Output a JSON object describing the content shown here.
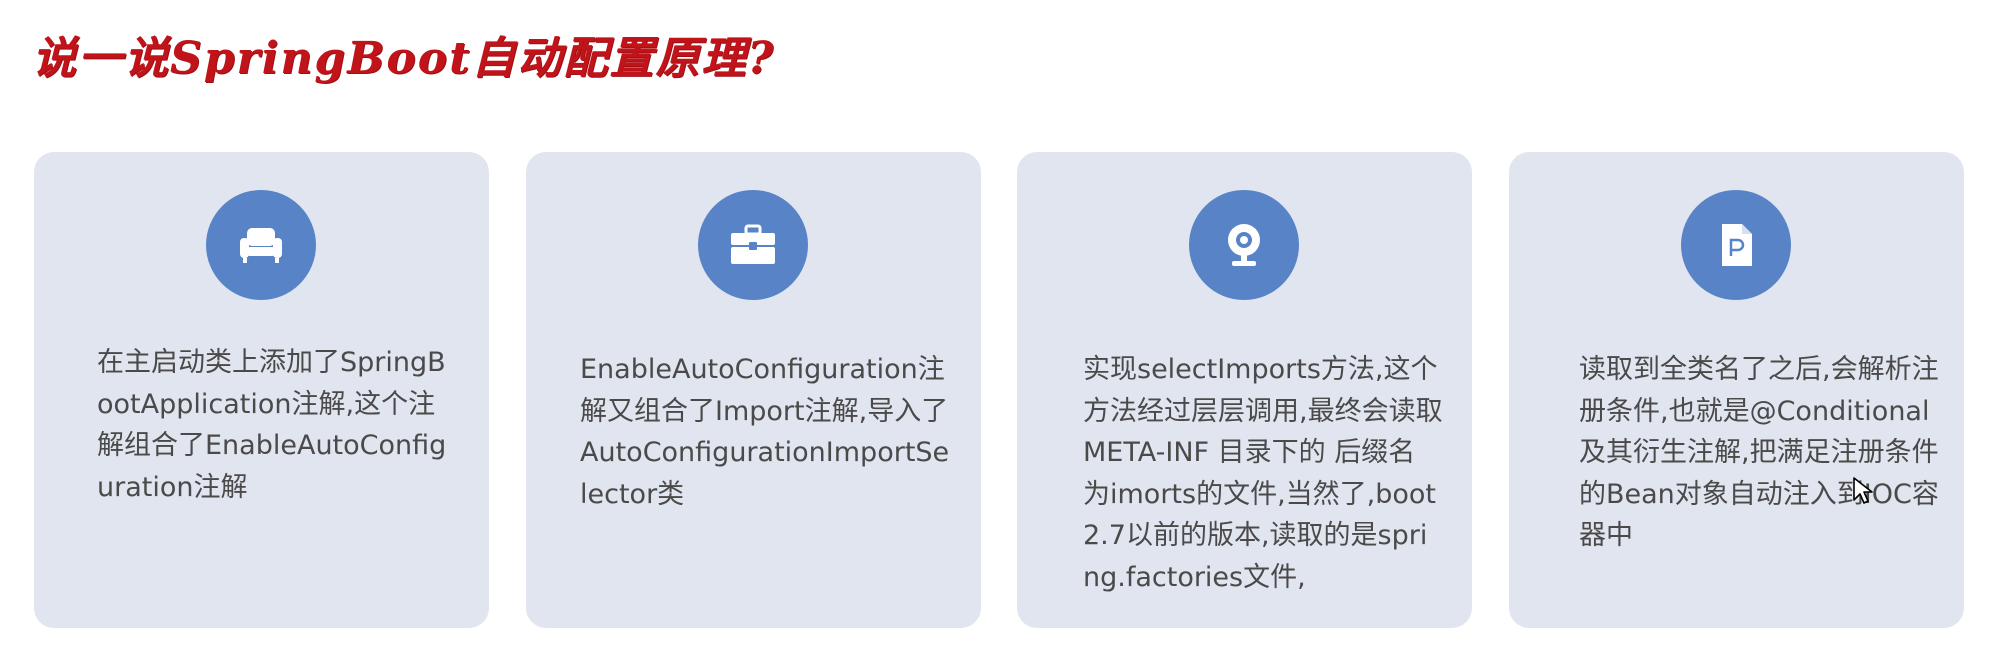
{
  "title": "说一说SpringBoot自动配置原理?",
  "cards": [
    {
      "icon": "armchair-icon",
      "text": "在主启动类上添加了SpringBootApplication注解,这个注解组合了EnableAutoConfiguration注解"
    },
    {
      "icon": "toolbox-icon",
      "text": "EnableAutoConfiguration注解又组合了Import注解,导入了AutoConfigurationImportSelector类"
    },
    {
      "icon": "webcam-icon",
      "text": "实现selectImports方法,这个方法经过层层调用,最终会读取META-INF 目录下的 后缀名 为imorts的文件,当然了,boot2.7以前的版本,读取的是spring.factories文件,"
    },
    {
      "icon": "p-document-icon",
      "text": "读取到全类名了之后,会解析注册条件,也就是@Conditional及其衍生注解,把满足注册条件的Bean对象自动注入到IOC容器中"
    }
  ],
  "colors": {
    "title": "#c0141a",
    "card_background": "#e1e5ef",
    "icon_circle": "#5884c7",
    "text": "#4a4a4a"
  }
}
